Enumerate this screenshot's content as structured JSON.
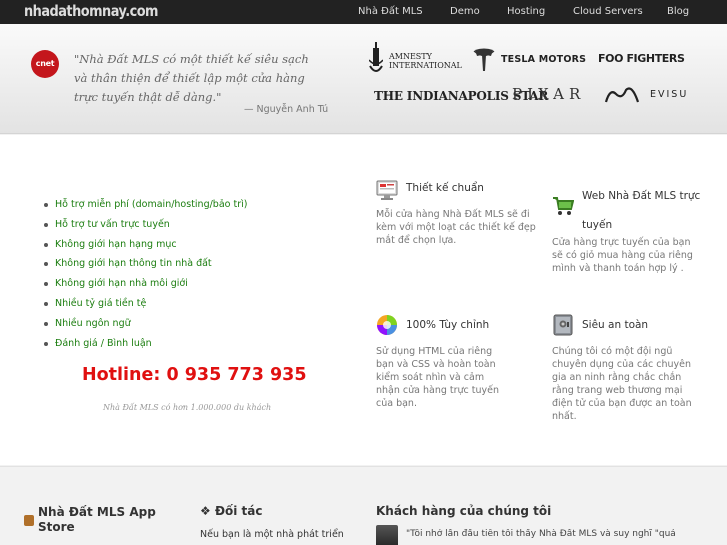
{
  "site": {
    "logo": "nhadathomnay.com"
  },
  "nav": {
    "items": [
      {
        "label": "Nhà Đất MLS"
      },
      {
        "label": "Demo"
      },
      {
        "label": "Hosting"
      },
      {
        "label": "Cloud Servers"
      },
      {
        "label": "Blog"
      }
    ]
  },
  "testimonial": {
    "source": "cnet",
    "quote": "\"Nhà Đất MLS có một thiết kế siêu sạch và thân thiện để thiết lập một cửa hàng trực tuyến thật dễ dàng.\"",
    "author": "— Nguyễn Anh Tú"
  },
  "brands": {
    "amnesty": "AMNESTY INTERNATIONAL",
    "amnesty_line1": "AMNESTY",
    "amnesty_line2": "INTERNATIONAL",
    "tesla": "TESLA MOTORS",
    "foo": "FOO FIGHTERS",
    "indy": "THE INDIANAPOLIS STAR",
    "pixar": "PIXAR",
    "evisu": "EVISU"
  },
  "features_list": [
    "Hỗ trợ miễn phí (domain/hosting/bảo trì)",
    "Hỗ trợ tư vấn trực tuyến",
    "Không giới hạn hạng mục",
    "Không giới hạn thông tin nhà đất",
    "Không giới hạn nhà môi giới",
    "Nhiều tỷ giá tiền tệ",
    "Nhiều ngôn ngữ",
    "Đánh giá / Bình luận"
  ],
  "hotline": "Hotline: 0 935 773 935",
  "stat_note": "Nhà Đất MLS có hơn 1.000.000 du khách",
  "features": [
    {
      "title": "Thiết kế chuẩn",
      "icon": "monitor-icon",
      "desc": "Mỗi cửa hàng Nhà Đất MLS sẽ đi kèm với một loạt các thiết kế đẹp mắt để chọn lựa."
    },
    {
      "title": "Web Nhà Đất MLS trực tuyến",
      "icon": "shopping-cart-icon",
      "desc": "Cửa hàng trực tuyến của bạn sẽ có giỏ mua hàng của riêng mình và thanh toán hợp lý ."
    },
    {
      "title": "100% Tùy chỉnh",
      "icon": "color-wheel-icon",
      "desc": "Sử dụng HTML của riêng bạn và CSS và hoàn toàn kiểm soát nhìn và cảm nhận cửa hàng trực tuyến của bạn."
    },
    {
      "title": "Siêu an toàn",
      "icon": "safe-icon",
      "desc": "Chúng tôi có một đội ngũ chuyên dụng của các chuyên gia an ninh rằng chắc chắn rằng trang web thương mại điện tử của bạn được an toàn nhất."
    }
  ],
  "bottom": {
    "app_title": "Nhà Đất MLS App Store",
    "partner_title": "Đối tác",
    "partner_text": "Nếu bạn là một nhà phát triển",
    "customers_title": "Khách hàng của chúng tôi",
    "customer_quote": "\"Tôi nhớ lần đầu tiên tôi thấy Nhà Đất MLS và suy nghĩ \"quá"
  },
  "colors": {
    "topbar": "#222222",
    "link_green": "#1b7d0f",
    "hotline_red": "#e01010",
    "cnet_red": "#c4161c"
  }
}
